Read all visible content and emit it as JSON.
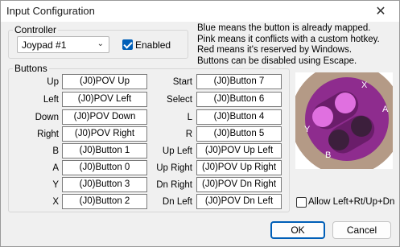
{
  "window": {
    "title": "Input Configuration",
    "close_glyph": "✕"
  },
  "controller": {
    "group_label": "Controller",
    "selected": "Joypad #1",
    "enabled_label": "Enabled",
    "enabled": true
  },
  "info_lines": [
    "Blue means the button is already mapped.",
    "Pink means it conflicts with a custom hotkey.",
    "Red means it's reserved by Windows.",
    "Buttons can be disabled using Escape."
  ],
  "buttons": {
    "group_label": "Buttons",
    "left": [
      {
        "label": "Up",
        "value": "(J0)POV Up"
      },
      {
        "label": "Left",
        "value": "(J0)POV Left"
      },
      {
        "label": "Down",
        "value": "(J0)POV Down"
      },
      {
        "label": "Right",
        "value": "(J0)POV Right"
      },
      {
        "label": "B",
        "value": "(J0)Button 1"
      },
      {
        "label": "A",
        "value": "(J0)Button 0"
      },
      {
        "label": "Y",
        "value": "(J0)Button 3"
      },
      {
        "label": "X",
        "value": "(J0)Button 2"
      }
    ],
    "right": [
      {
        "label": "Start",
        "value": "(J0)Button 7"
      },
      {
        "label": "Select",
        "value": "(J0)Button 6"
      },
      {
        "label": "L",
        "value": "(J0)Button 4"
      },
      {
        "label": "R",
        "value": "(J0)Button 5"
      },
      {
        "label": "Up Left",
        "value": "(J0)POV Up Left"
      },
      {
        "label": "Up Right",
        "value": "(J0)POV Up Right"
      },
      {
        "label": "Dn Right",
        "value": "(J0)POV Dn Right"
      },
      {
        "label": "Dn Left",
        "value": "(J0)POV Dn Left"
      }
    ]
  },
  "pad_image": {
    "letters": {
      "x": "X",
      "y": "Y",
      "a": "A",
      "b": "B"
    },
    "colors": {
      "base": "#b49a86",
      "body": "#8e2c8e",
      "highlight": "#e070e0",
      "dark": "#3c1f3c"
    }
  },
  "allow_opposite": {
    "label": "Allow Left+Rt/Up+Dn",
    "checked": false
  },
  "footer": {
    "ok_label": "OK",
    "cancel_label": "Cancel"
  }
}
